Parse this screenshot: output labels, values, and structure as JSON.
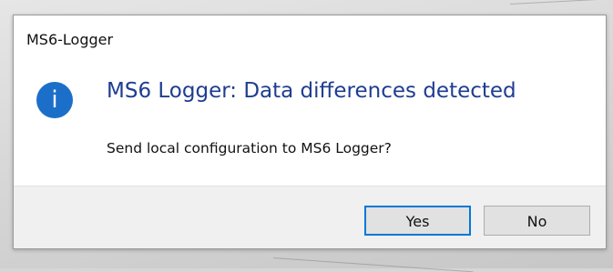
{
  "window": {
    "title": "MS6-Logger"
  },
  "message": {
    "icon": "information-icon",
    "icon_glyph": "i",
    "icon_color": "#1c6fc9",
    "main_instruction": "MS6 Logger: Data differences detected",
    "main_instruction_color": "#1f3d91",
    "content": "Send local configuration to MS6 Logger?"
  },
  "buttons": {
    "yes_label": "Yes",
    "no_label": "No",
    "default_button": "yes",
    "focus_color": "#0078d7"
  }
}
